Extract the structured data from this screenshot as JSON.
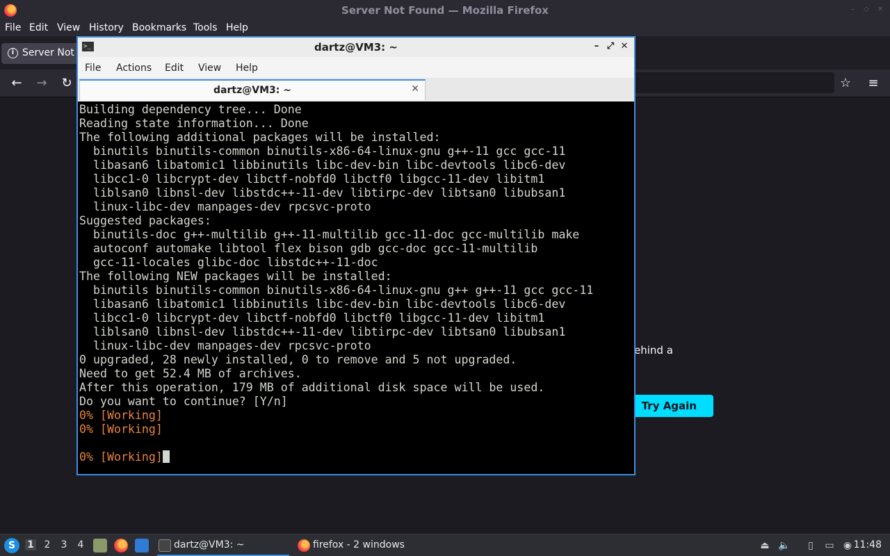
{
  "firefox": {
    "window_title": "Server Not Found — Mozilla Firefox",
    "menu": [
      "File",
      "Edit",
      "View",
      "History",
      "Bookmarks",
      "Tools",
      "Help"
    ],
    "tab_label": "Server Not F",
    "page": {
      "error_text_fragment": "ehind a",
      "try_again_label": "Try Again"
    }
  },
  "terminal": {
    "window_title": "dartz@VM3: ~",
    "menu": [
      "File",
      "Actions",
      "Edit",
      "View",
      "Help"
    ],
    "tab_label": "dartz@VM3: ~",
    "tab_close": "✕",
    "lines": [
      "Building dependency tree... Done",
      "Reading state information... Done",
      "The following additional packages will be installed:",
      "  binutils binutils-common binutils-x86-64-linux-gnu g++-11 gcc gcc-11",
      "  libasan6 libatomic1 libbinutils libc-dev-bin libc-devtools libc6-dev",
      "  libcc1-0 libcrypt-dev libctf-nobfd0 libctf0 libgcc-11-dev libitm1",
      "  liblsan0 libnsl-dev libstdc++-11-dev libtirpc-dev libtsan0 libubsan1",
      "  linux-libc-dev manpages-dev rpcsvc-proto",
      "Suggested packages:",
      "  binutils-doc g++-multilib g++-11-multilib gcc-11-doc gcc-multilib make",
      "  autoconf automake libtool flex bison gdb gcc-doc gcc-11-multilib",
      "  gcc-11-locales glibc-doc libstdc++-11-doc",
      "The following NEW packages will be installed:",
      "  binutils binutils-common binutils-x86-64-linux-gnu g++ g++-11 gcc gcc-11",
      "  libasan6 libatomic1 libbinutils libc-dev-bin libc-devtools libc6-dev",
      "  libcc1-0 libcrypt-dev libctf-nobfd0 libctf0 libgcc-11-dev libitm1",
      "  liblsan0 libnsl-dev libstdc++-11-dev libtirpc-dev libtsan0 libubsan1",
      "  linux-libc-dev manpages-dev rpcsvc-proto",
      "0 upgraded, 28 newly installed, 0 to remove and 5 not upgraded.",
      "Need to get 52.4 MB of archives.",
      "After this operation, 179 MB of additional disk space will be used.",
      "Do you want to continue? [Y/n]",
      "0% [Working]",
      "0% [Working]",
      "",
      "0% [Working]"
    ]
  },
  "taskbar": {
    "workspaces": [
      "1",
      "2",
      "3",
      "4"
    ],
    "active_workspace": "1",
    "task_terminal": "dartz@VM3: ~",
    "task_firefox": "firefox - 2 windows",
    "clock": "11:48"
  },
  "colors": {
    "accent": "#3d8ee1",
    "terminal_bg": "#000000",
    "terminal_fg": "#d3d7cf",
    "terminal_progress": "#e8843c",
    "try_again_bg": "#00ddff"
  }
}
